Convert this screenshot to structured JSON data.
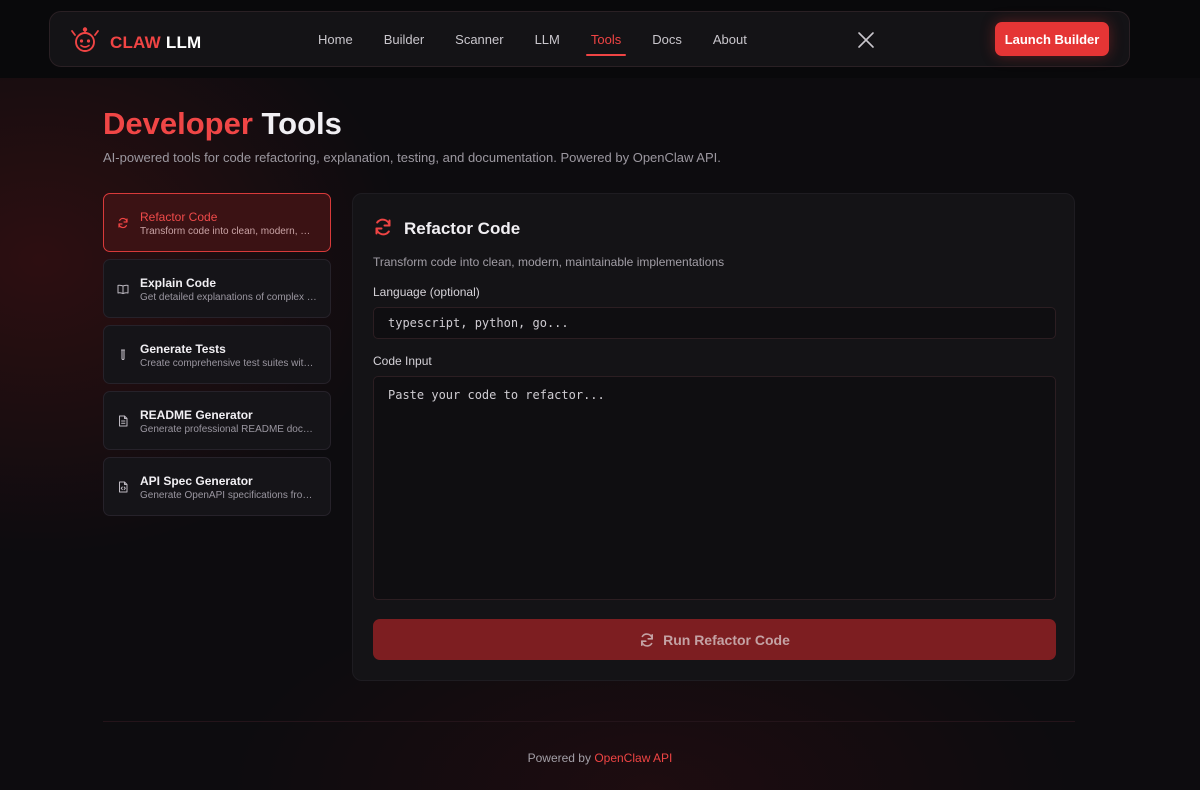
{
  "header": {
    "brand": {
      "claw": "CLAW",
      "llm": "LLM",
      "logo_icon": "robot-claw-logo"
    },
    "nav": [
      {
        "label": "Home",
        "active": false
      },
      {
        "label": "Builder",
        "active": false
      },
      {
        "label": "Scanner",
        "active": false
      },
      {
        "label": "LLM",
        "active": false
      },
      {
        "label": "Tools",
        "active": true
      },
      {
        "label": "Docs",
        "active": false
      },
      {
        "label": "About",
        "active": false
      }
    ],
    "social_icon": "x-icon",
    "launch_label": "Launch Builder"
  },
  "page": {
    "title_red": "Developer",
    "title_white": "Tools",
    "subtitle": "AI-powered tools for code refactoring, explanation, testing, and documentation. Powered by OpenClaw API."
  },
  "tools": [
    {
      "name": "Refactor Code",
      "desc": "Transform code into clean, modern, maintainable implementations",
      "icon": "refresh-icon",
      "active": true
    },
    {
      "name": "Explain Code",
      "desc": "Get detailed explanations of complex code",
      "icon": "book-icon",
      "active": false
    },
    {
      "name": "Generate Tests",
      "desc": "Create comprehensive test suites with coverage",
      "icon": "test-tube-icon",
      "active": false
    },
    {
      "name": "README Generator",
      "desc": "Generate professional README documentation",
      "icon": "file-text-icon",
      "active": false
    },
    {
      "name": "API Spec Generator",
      "desc": "Generate OpenAPI specifications from code",
      "icon": "file-code-icon",
      "active": false
    }
  ],
  "panel": {
    "title": "Refactor Code",
    "icon": "refresh-icon",
    "desc": "Transform code into clean, modern, maintainable implementations",
    "language_label": "Language (optional)",
    "language_value": "",
    "language_placeholder": "typescript, python, go...",
    "code_label": "Code Input",
    "code_value": "",
    "code_placeholder": "Paste your code to refactor...",
    "run_label": "Run Refactor Code"
  },
  "footer": {
    "prefix": "Powered by",
    "link": "OpenClaw API"
  },
  "colors": {
    "accent": "#ef4444",
    "background": "#0d0c0f",
    "panel": "#141316"
  }
}
